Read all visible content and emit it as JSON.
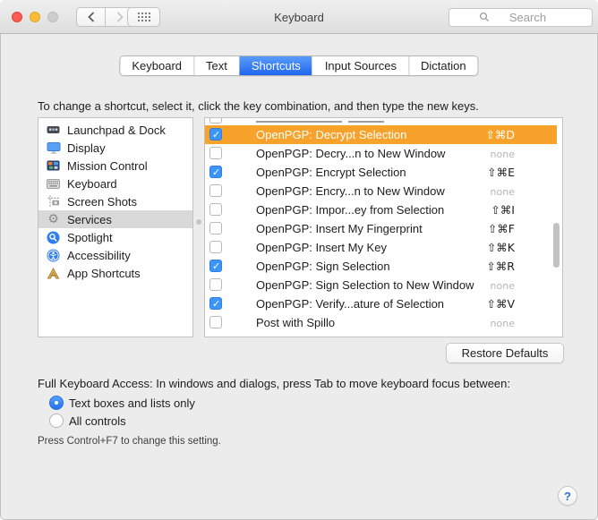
{
  "window": {
    "title": "Keyboard",
    "search_placeholder": "Search",
    "traffic_lights": [
      {
        "name": "close",
        "color": "#fc5b51"
      },
      {
        "name": "minimize",
        "color": "#fdbc33"
      },
      {
        "name": "zoom-disabled",
        "color": "#cecece"
      }
    ]
  },
  "tabs": [
    {
      "label": "Keyboard",
      "selected": false
    },
    {
      "label": "Text",
      "selected": false
    },
    {
      "label": "Shortcuts",
      "selected": true
    },
    {
      "label": "Input Sources",
      "selected": false
    },
    {
      "label": "Dictation",
      "selected": false
    }
  ],
  "instruction": "To change a shortcut, select it, click the key combination, and then type the new keys.",
  "sidebar": {
    "items": [
      {
        "label": "Launchpad & Dock",
        "icon": "dock-icon",
        "selected": false
      },
      {
        "label": "Display",
        "icon": "display-icon",
        "selected": false
      },
      {
        "label": "Mission Control",
        "icon": "mission-control-icon",
        "selected": false
      },
      {
        "label": "Keyboard",
        "icon": "keyboard-icon",
        "selected": false
      },
      {
        "label": "Screen Shots",
        "icon": "screen-shots-icon",
        "selected": false
      },
      {
        "label": "Services",
        "icon": "gear-icon",
        "selected": true
      },
      {
        "label": "Spotlight",
        "icon": "spotlight-icon",
        "selected": false
      },
      {
        "label": "Accessibility",
        "icon": "accessibility-icon",
        "selected": false
      },
      {
        "label": "App Shortcuts",
        "icon": "app-shortcuts-icon",
        "selected": false
      }
    ]
  },
  "shortcut_list": {
    "rows": [
      {
        "label": "OpenPGP: Decrypt Selection",
        "shortcut": "⇧⌘D",
        "checked": true,
        "selected": true
      },
      {
        "label": "OpenPGP: Decry...n to New Window",
        "shortcut": "none",
        "checked": false,
        "selected": false
      },
      {
        "label": "OpenPGP: Encrypt Selection",
        "shortcut": "⇧⌘E",
        "checked": true,
        "selected": false
      },
      {
        "label": "OpenPGP: Encry...n to New Window",
        "shortcut": "none",
        "checked": false,
        "selected": false
      },
      {
        "label": "OpenPGP: Impor...ey from Selection",
        "shortcut": "⇧⌘I",
        "checked": false,
        "selected": false
      },
      {
        "label": "OpenPGP: Insert My Fingerprint",
        "shortcut": "⇧⌘F",
        "checked": false,
        "selected": false
      },
      {
        "label": "OpenPGP: Insert My Key",
        "shortcut": "⇧⌘K",
        "checked": false,
        "selected": false
      },
      {
        "label": "OpenPGP: Sign Selection",
        "shortcut": "⇧⌘R",
        "checked": true,
        "selected": false
      },
      {
        "label": "OpenPGP: Sign Selection to New Window",
        "shortcut": "none",
        "checked": false,
        "selected": false
      },
      {
        "label": "OpenPGP: Verify...ature of Selection",
        "shortcut": "⇧⌘V",
        "checked": true,
        "selected": false
      },
      {
        "label": "Post with Spillo",
        "shortcut": "none",
        "checked": false,
        "selected": false
      }
    ],
    "selection_color": "#f7a22b",
    "checkbox_color": "#3c96f8"
  },
  "actions": {
    "restore_defaults": "Restore Defaults"
  },
  "full_keyboard_access": {
    "heading": "Full Keyboard Access: In windows and dialogs, press Tab to move keyboard focus between:",
    "options": [
      {
        "label": "Text boxes and lists only",
        "selected": true
      },
      {
        "label": "All controls",
        "selected": false
      }
    ],
    "note": "Press Control+F7 to change this setting."
  },
  "help_button_label": "?"
}
